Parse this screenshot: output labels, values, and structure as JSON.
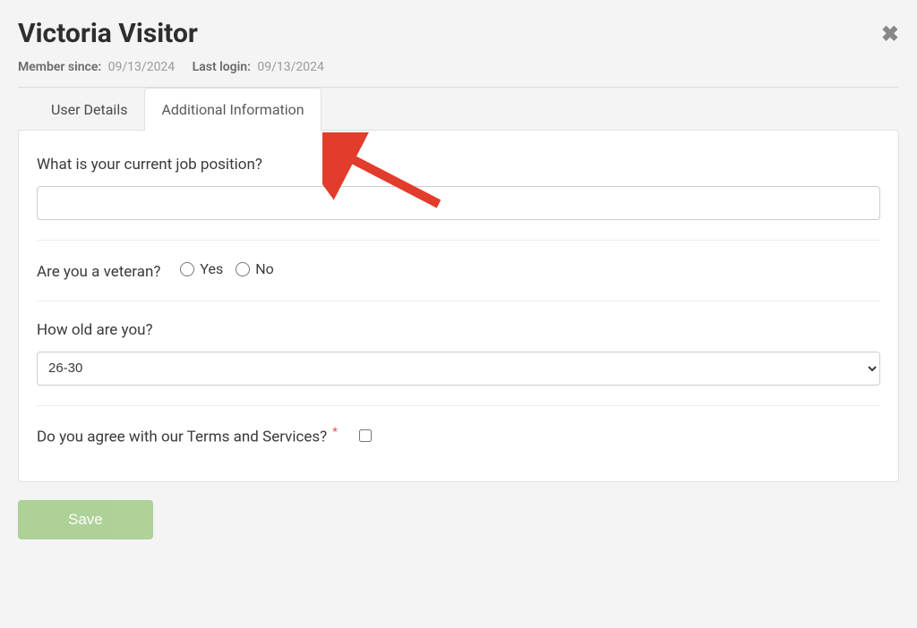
{
  "header": {
    "title": "Victoria Visitor",
    "member_since_label": "Member since:",
    "member_since_value": "09/13/2024",
    "last_login_label": "Last login:",
    "last_login_value": "09/13/2024"
  },
  "tabs": {
    "user_details": "User Details",
    "additional_info": "Additional Information"
  },
  "form": {
    "job_position": {
      "label": "What is your current job position?",
      "value": ""
    },
    "veteran": {
      "label": "Are you a veteran?",
      "option_yes": "Yes",
      "option_no": "No"
    },
    "age": {
      "label": "How old are you?",
      "value": "26-30"
    },
    "terms": {
      "label": "Do you agree with our Terms and Services?",
      "required_mark": "*",
      "checked": false
    }
  },
  "buttons": {
    "save": "Save"
  }
}
